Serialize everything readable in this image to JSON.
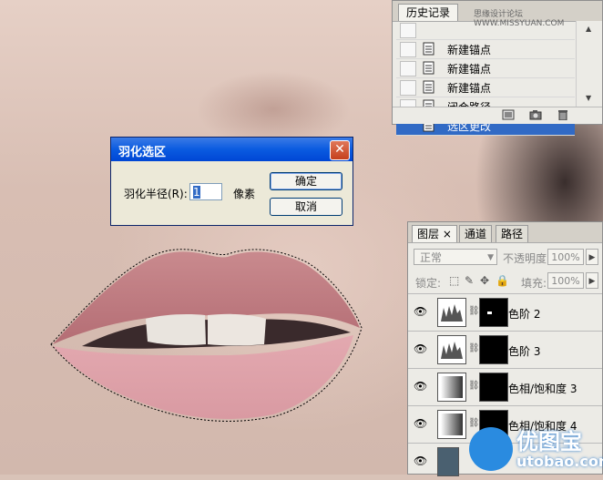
{
  "history_panel": {
    "tab_label": "历史记录",
    "rows": [
      {
        "label": ""
      },
      {
        "label": "新建锚点"
      },
      {
        "label": "新建锚点"
      },
      {
        "label": "新建锚点"
      },
      {
        "label": "闭合路径"
      },
      {
        "label": "选区更改",
        "selected": true
      }
    ]
  },
  "dialog": {
    "title": "羽化选区",
    "radius_label": "羽化半径(R):",
    "radius_value": "1",
    "unit": "像素",
    "ok_label": "确定",
    "cancel_label": "取消"
  },
  "layers_panel": {
    "tabs": [
      "图层",
      "通道",
      "路径"
    ],
    "blend_mode": "正常",
    "opacity_label": "不透明度:",
    "opacity_value": "100%",
    "lock_label": "锁定:",
    "fill_label": "填充:",
    "fill_value": "100%",
    "layers": [
      {
        "name": "色阶 2"
      },
      {
        "name": "色阶 3"
      },
      {
        "name": "色相/饱和度 3"
      },
      {
        "name": "色相/饱和度 4"
      },
      {
        "name": ""
      }
    ]
  },
  "watermark": {
    "top_site": "思缘设计论坛 WWW.MISSYUAN.COM",
    "logo_big": "优图宝",
    "logo_small": "utobao.com"
  },
  "colors": {
    "selection_blue": "#316ac5",
    "dialog_title_blue": "#0a5be0",
    "close_red": "#c5401c"
  }
}
